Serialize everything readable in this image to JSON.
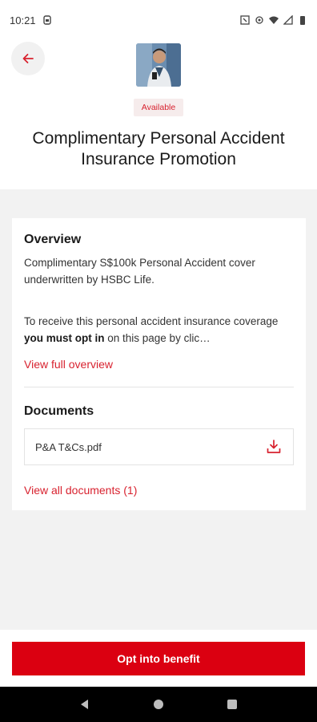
{
  "status": {
    "time": "10:21",
    "icons": [
      "sim-icon",
      "nfc-icon",
      "vibrate-icon",
      "wifi-icon",
      "signal-icon",
      "battery-icon"
    ]
  },
  "header": {
    "back_icon": "arrow-left-icon",
    "badge": "Available",
    "title": "Complimentary Personal Accident Insurance Promotion"
  },
  "overview": {
    "heading": "Overview",
    "para1": "Complimentary S$100k Personal Accident cover underwritten by HSBC Life.",
    "para2_before": "To receive this personal accident insurance coverage ",
    "para2_bold": "you must opt in",
    "para2_after": " on this page by clic…",
    "link": "View full overview"
  },
  "documents": {
    "heading": "Documents",
    "items": [
      {
        "name": "P&A T&Cs.pdf",
        "icon": "download-icon"
      }
    ],
    "link": "View all documents (1)"
  },
  "cta": {
    "label": "Opt into benefit"
  },
  "colors": {
    "brand_red": "#db0011",
    "link_red": "#d8222f",
    "badge_bg": "#f6ecec"
  }
}
